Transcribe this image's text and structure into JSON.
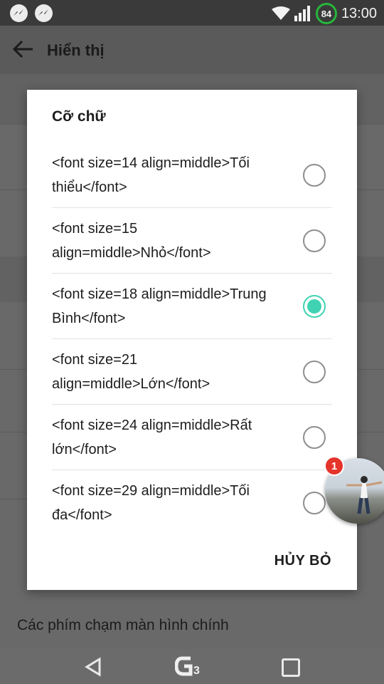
{
  "status_bar": {
    "notification_icons": [
      "messenger-icon",
      "messenger-icon"
    ],
    "wifi_icon": "wifi-icon",
    "signal_icon": "signal-icon",
    "battery_level": "84",
    "time": "13:00"
  },
  "app_bar": {
    "back_icon": "back-arrow-icon",
    "title": "Hiển thị"
  },
  "background_page": {
    "last_item": "Các phím chạm màn hình chính"
  },
  "dialog": {
    "title": "Cỡ chữ",
    "options": [
      {
        "label": "<font size=14 align=middle>Tối thiểu</font>",
        "selected": false
      },
      {
        "label": "<font size=15 align=middle>Nhỏ</font>",
        "selected": false
      },
      {
        "label": "<font size=18 align=middle>Trung Bình</font>",
        "selected": true
      },
      {
        "label": "<font size=21 align=middle>Lớn</font>",
        "selected": false
      },
      {
        "label": "<font size=24 align=middle>Rất lớn</font>",
        "selected": false
      },
      {
        "label": "<font size=29 align=middle>Tối đa</font>",
        "selected": false
      }
    ],
    "cancel_label": "HỦY BỎ",
    "accent_color": "#3fd3b3"
  },
  "chat_head": {
    "badge_count": "1"
  },
  "nav_bar": {
    "back_icon": "nav-back-icon",
    "logo": "G3",
    "recents_icon": "recents-icon"
  }
}
